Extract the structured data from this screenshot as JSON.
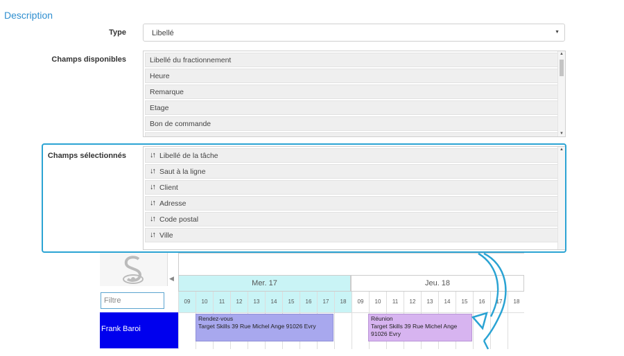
{
  "section": {
    "title": "Description"
  },
  "type_field": {
    "label": "Type",
    "value": "Libellé"
  },
  "available": {
    "label": "Champs disponibles",
    "items": [
      {
        "label": "Libellé du fractionnement"
      },
      {
        "label": "Heure"
      },
      {
        "label": "Remarque"
      },
      {
        "label": "Etage"
      },
      {
        "label": "Bon de commande"
      }
    ]
  },
  "selected": {
    "label": "Champs sélectionnés",
    "items": [
      {
        "label": "Libellé de la tâche"
      },
      {
        "label": "Saut à la ligne"
      },
      {
        "label": "Client"
      },
      {
        "label": "Adresse"
      },
      {
        "label": "Code postal"
      },
      {
        "label": "Ville"
      }
    ]
  },
  "planning": {
    "filter_placeholder": "Filtre",
    "days": [
      "Mer. 17",
      "Jeu. 18"
    ],
    "hours": [
      "09",
      "10",
      "11",
      "12",
      "13",
      "14",
      "15",
      "16",
      "17",
      "18",
      "09",
      "10",
      "11",
      "12",
      "13",
      "14",
      "15",
      "16",
      "17",
      "18"
    ],
    "resource": "Frank Baroi",
    "events": [
      {
        "line1": "Rendez-vous",
        "line2": "Target Skills 39 Rue Michel Ange 91026 Evry"
      },
      {
        "line1": "Réunion",
        "line2": "Target Skills 39 Rue Michel Ange",
        "line3": "91026 Evry"
      }
    ]
  },
  "icons": {
    "add": "plus-icon",
    "remove": "close-icon",
    "sort": "sort-icon"
  },
  "colors": {
    "accent": "#2aa3d3",
    "title": "#2f8fd0",
    "resource_bg": "#0000ee",
    "event1": "#a8a8ee",
    "event2": "#d7b4f0",
    "day_highlight": "#c9f4f6"
  }
}
